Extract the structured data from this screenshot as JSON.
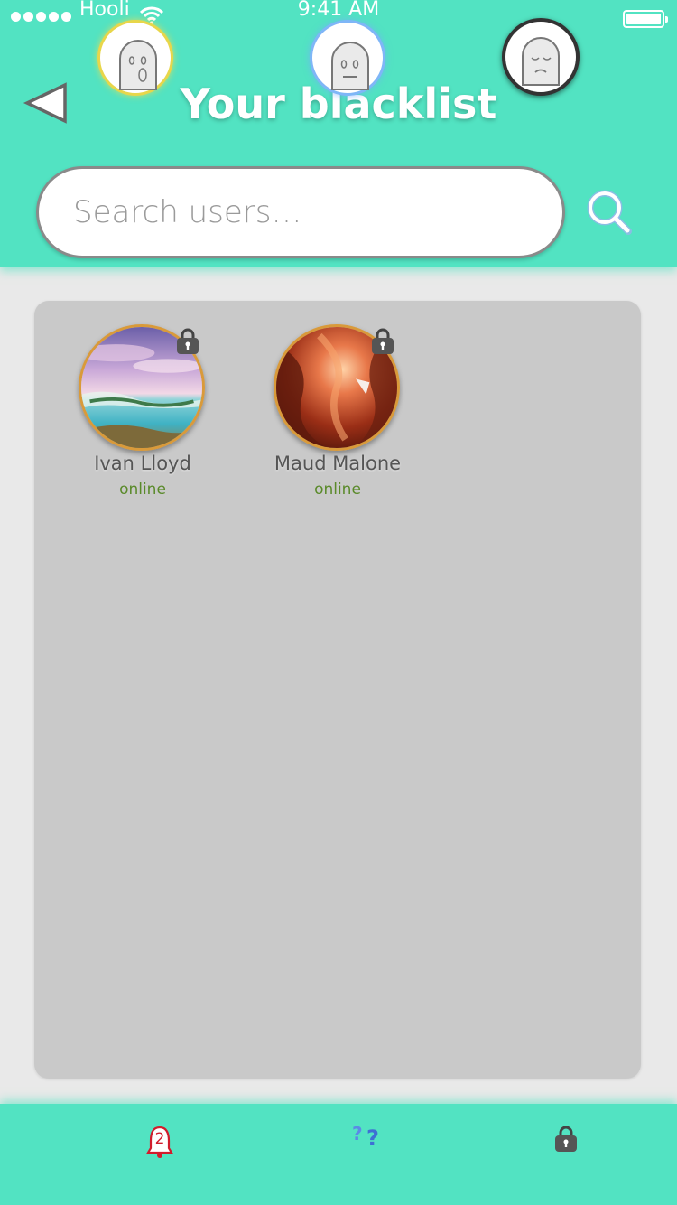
{
  "status_bar": {
    "carrier": "Hooli",
    "time": "9:41 AM"
  },
  "header": {
    "title": "Your blacklist"
  },
  "search": {
    "placeholder": "Search users…",
    "value": ""
  },
  "blacklist": [
    {
      "name": "Ivan Lloyd",
      "status": "online",
      "avatar": "beach-lagoon-photo"
    },
    {
      "name": "Maud Malone",
      "status": "online",
      "avatar": "red-canyon-photo"
    }
  ],
  "footer": {
    "notification_count": "2"
  },
  "colors": {
    "accent": "#52e3c2",
    "panel": "#c9c9c9",
    "online": "#5a8a2a",
    "badge": "#d21c2c"
  },
  "icons": [
    "back-arrow-icon",
    "search-icon",
    "lock-icon",
    "bell-icon",
    "question-icon"
  ]
}
